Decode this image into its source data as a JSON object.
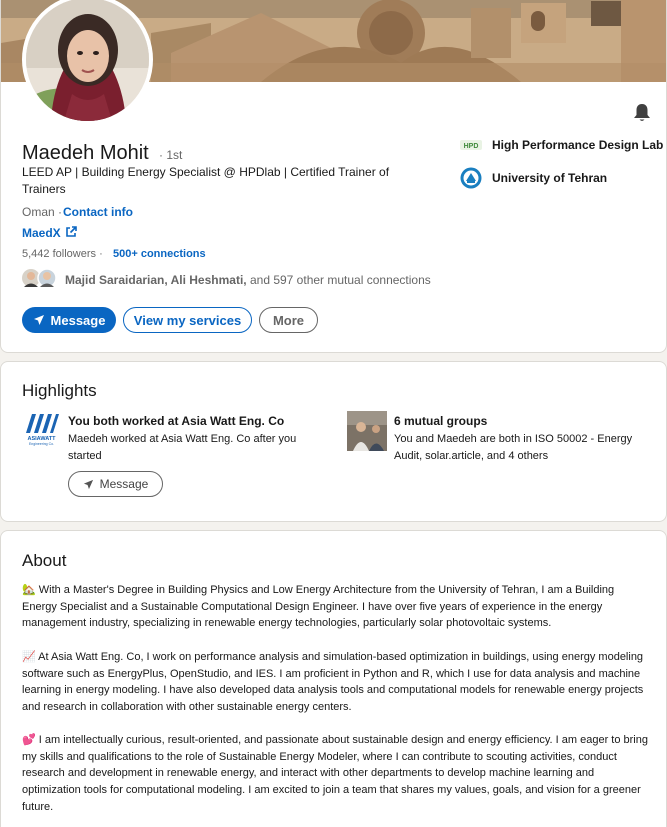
{
  "profile": {
    "name": "Maedeh Mohit",
    "degree": "· 1st",
    "headline": "LEED AP | Building Energy Specialist @ HPDlab | Certified Trainer of Trainers",
    "location": "Oman ·",
    "contact_info": "Contact info",
    "website": "MaedX",
    "followers": "5,442 followers",
    "connections_separator": "·",
    "connections": "500+ connections",
    "mutual_names": "Majid Saraidarian, Ali Heshmati,",
    "mutual_rest": "and 597 other mutual connections",
    "buttons": {
      "message": "Message",
      "services": "View my services",
      "more": "More"
    },
    "organizations": [
      {
        "name": "High Performance Design Lab",
        "logo_text": "HPD"
      },
      {
        "name": "University of Tehran"
      }
    ]
  },
  "highlights": {
    "title": "Highlights",
    "work": {
      "logo_text": "ASIAWATT",
      "logo_subtext": "Engineering Co.",
      "title": "You both worked at Asia Watt Eng. Co",
      "description": "Maedeh worked at Asia Watt Eng. Co after you started",
      "button": "Message"
    },
    "groups": {
      "title": "6 mutual groups",
      "description": "You and Maedeh are both in ISO 50002 - Energy Audit, solar.article, and 4 others"
    }
  },
  "about": {
    "title": "About",
    "paragraphs": [
      "🏡 With a Master's Degree in Building Physics and Low Energy Architecture from the University of Tehran, I am a Building Energy Specialist and a Sustainable Computational Design Engineer. I have over five years of experience in the energy management industry, specializing in renewable energy technologies, particularly solar photovoltaic systems.",
      "📈 At Asia Watt Eng. Co, I work on performance analysis and simulation-based optimization in buildings, using energy modeling software such as EnergyPlus, OpenStudio, and IES. I am proficient in Python and R, which I use for data analysis and machine learning in energy modeling. I have also developed data analysis tools and computational models for renewable energy projects and research in collaboration with other sustainable energy centers.",
      "💕 I am intellectually curious, result-oriented, and passionate about sustainable design and energy efficiency. I am eager to bring my skills and qualifications to the role of Sustainable Energy Modeler, where I can contribute to scouting activities, conduct research and development in renewable energy, and interact with other departments to develop machine learning and optimization tools for computational modeling. I am excited to join a team that shares my values, goals, and vision for a greener future."
    ]
  },
  "colors": {
    "accent": "#0a66c2",
    "text": "#191919",
    "muted": "#666666",
    "background": "#f4f2ee"
  }
}
